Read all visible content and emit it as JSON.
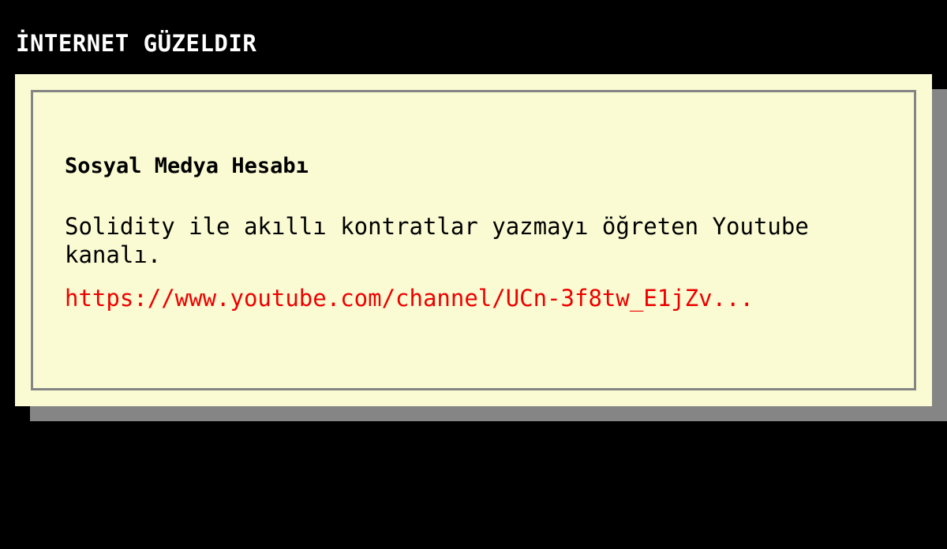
{
  "site": {
    "title": "İNTERNET GÜZELDIR"
  },
  "card": {
    "title": "Sosyal Medya Hesabı",
    "description": "Solidity ile akıllı kontratlar yazmayı öğreten Youtube kanalı.",
    "link_text": "https://www.youtube.com/channel/UCn-3f8tw_E1jZv..."
  },
  "colors": {
    "background": "#000000",
    "card_background": "#fafbd3",
    "card_border": "#858585",
    "link": "#ee0000"
  }
}
